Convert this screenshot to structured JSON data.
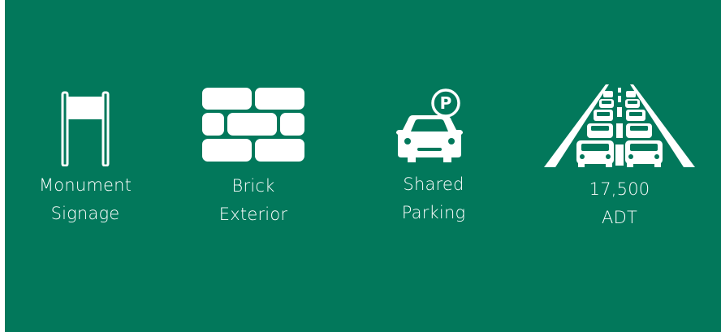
{
  "colors": {
    "background": "#02785b",
    "foreground": "#ffffff"
  },
  "features": [
    {
      "icon": "monument-sign-icon",
      "label_line1": "Monument",
      "label_line2": "Signage"
    },
    {
      "icon": "brick-wall-icon",
      "label_line1": "Brick",
      "label_line2": "Exterior"
    },
    {
      "icon": "parking-car-icon",
      "label_line1": "Shared",
      "label_line2": "Parking"
    },
    {
      "icon": "traffic-road-icon",
      "label_line1": "17,500",
      "label_line2": "ADT"
    }
  ]
}
